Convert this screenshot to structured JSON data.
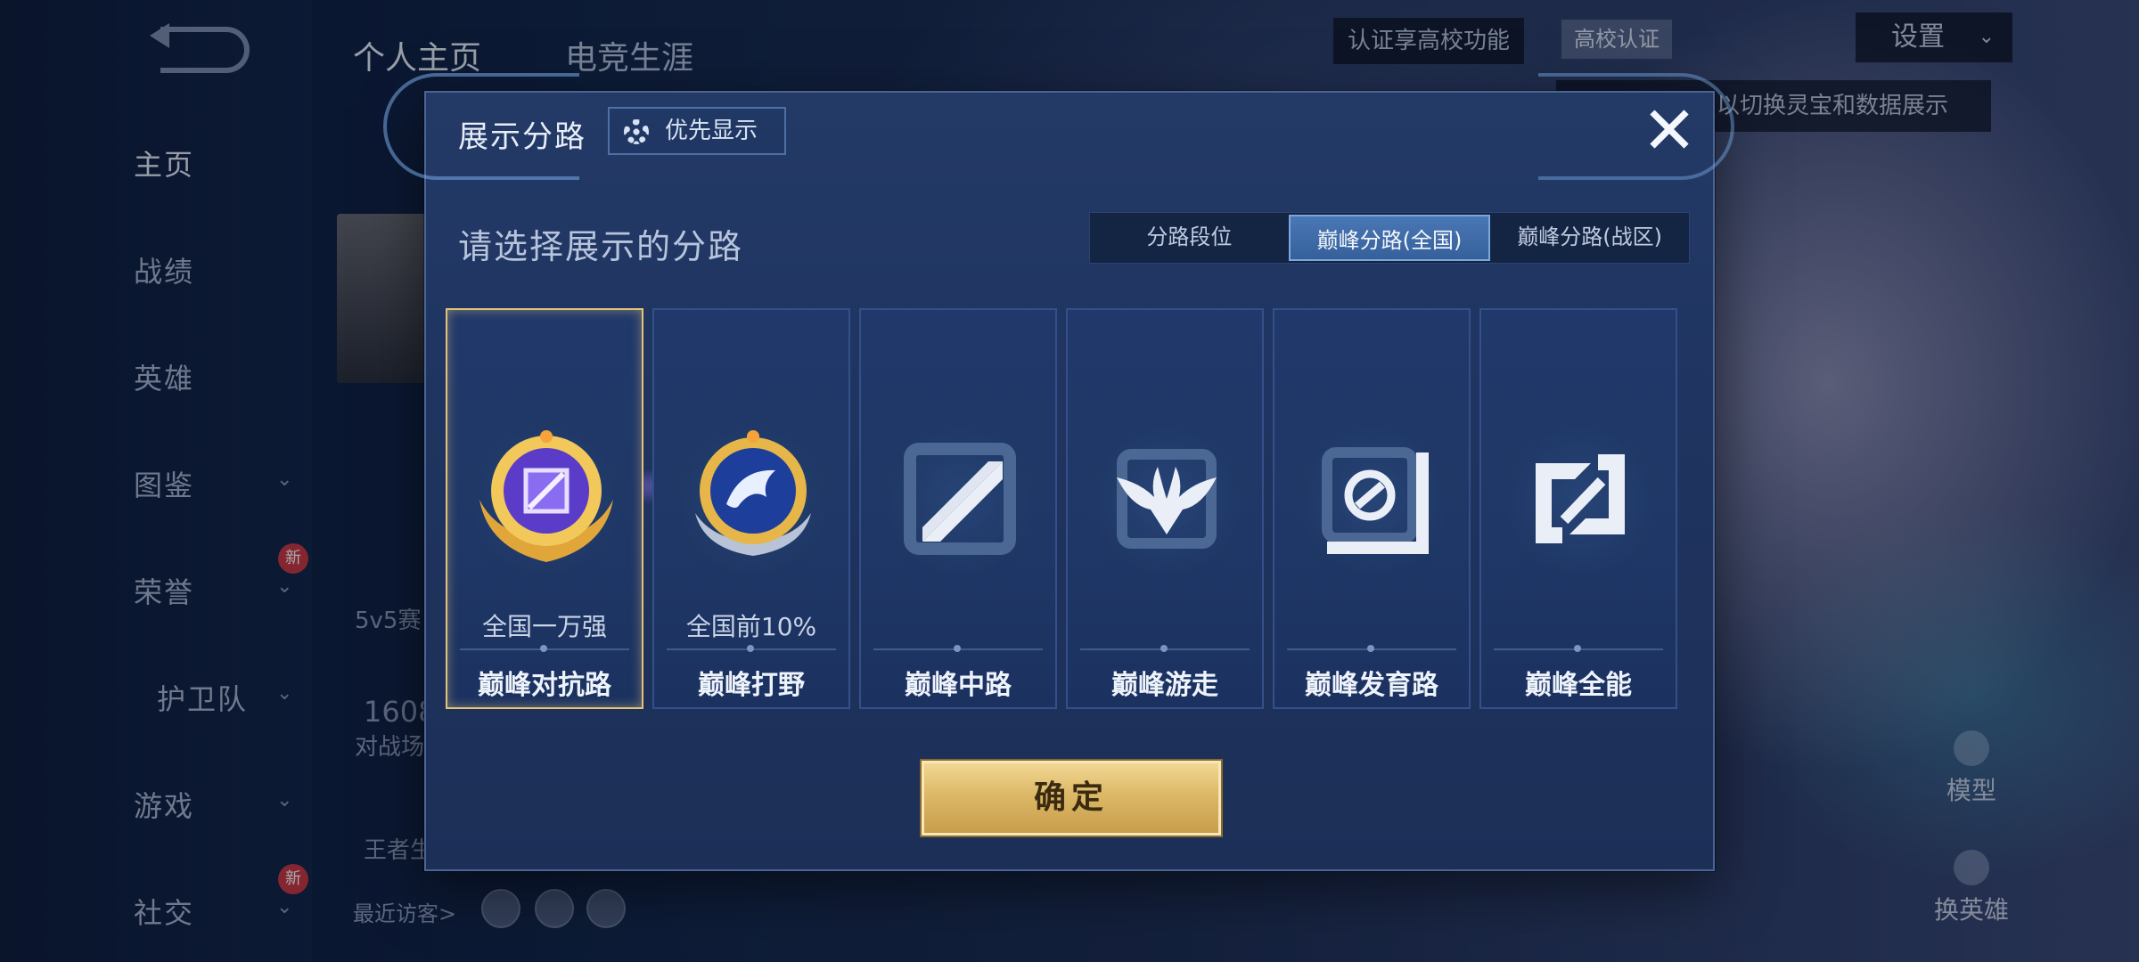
{
  "background": {
    "nav": {
      "items": [
        {
          "label": "主页",
          "active": true
        },
        {
          "label": "战绩"
        },
        {
          "label": "英雄"
        },
        {
          "label": "图鉴",
          "has_chevron": true
        },
        {
          "label": "荣誉",
          "has_chevron": true,
          "badge": "新"
        },
        {
          "label": "护卫队",
          "has_chevron": true
        },
        {
          "label": "游戏",
          "has_chevron": true
        },
        {
          "label": "社交",
          "has_chevron": true,
          "badge": "新"
        }
      ]
    },
    "top_tabs": [
      {
        "label": "个人主页",
        "active": true
      },
      {
        "label": "电竞生涯"
      }
    ],
    "cert_text": "认证享高校功能",
    "cert_button": "高校认证",
    "settings_label": "设置",
    "tip_text": "以切换灵宝和数据展示",
    "behind_texts": {
      "mode": "5v5赛",
      "count": "1608",
      "count_label": "对战场",
      "king": "王者生"
    },
    "right_buttons": [
      {
        "label": "模型"
      },
      {
        "label": "换英雄"
      }
    ],
    "visitors_label": "最近访客>"
  },
  "modal": {
    "title": "展示分路",
    "priority_button": "优先显示",
    "prompt": "请选择展示的分路",
    "tabs": [
      {
        "label": "分路段位"
      },
      {
        "label": "巅峰分路(全国)",
        "active": true
      },
      {
        "label": "巅峰分路(战区)"
      }
    ],
    "cards": [
      {
        "label": "巅峰对抗路",
        "subtitle": "全国一万强",
        "selected": true,
        "icon": "gold-purple-medal-icon"
      },
      {
        "label": "巅峰打野",
        "subtitle": "全国前10%",
        "icon": "dragon-medal-icon"
      },
      {
        "label": "巅峰中路",
        "subtitle": "",
        "icon": "mid-lane-icon"
      },
      {
        "label": "巅峰游走",
        "subtitle": "",
        "icon": "roam-wings-icon"
      },
      {
        "label": "巅峰发育路",
        "subtitle": "",
        "icon": "bot-lane-icon"
      },
      {
        "label": "巅峰全能",
        "subtitle": "",
        "icon": "all-round-icon"
      }
    ],
    "confirm_label": "确定",
    "close_icon": "close-icon"
  },
  "colors": {
    "gold": "#e3c27a",
    "panel": "#1f3460",
    "active_tab": "#4a78b4"
  }
}
